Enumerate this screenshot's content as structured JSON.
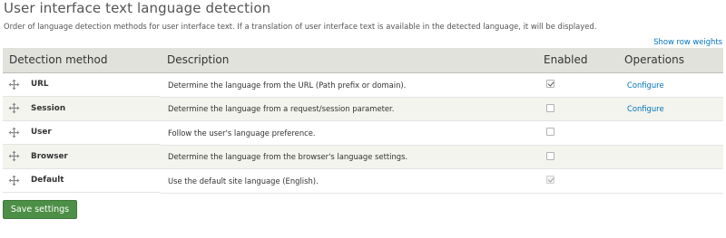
{
  "page": {
    "title": "User interface text language detection",
    "description": "Order of language detection methods for user interface text. If a translation of user interface text is available in the detected language, it will be displayed.",
    "row_weights_link": "Show row weights"
  },
  "table": {
    "headers": {
      "method": "Detection method",
      "description": "Description",
      "enabled": "Enabled",
      "operations": "Operations"
    },
    "rows": [
      {
        "method": "URL",
        "description": "Determine the language from the URL (Path prefix or domain).",
        "enabled": true,
        "disabled": false,
        "operation": "Configure"
      },
      {
        "method": "Session",
        "description": "Determine the language from a request/session parameter.",
        "enabled": false,
        "disabled": false,
        "operation": "Configure"
      },
      {
        "method": "User",
        "description": "Follow the user's language preference.",
        "enabled": false,
        "disabled": false,
        "operation": ""
      },
      {
        "method": "Browser",
        "description": "Determine the language from the browser's language settings.",
        "enabled": false,
        "disabled": false,
        "operation": ""
      },
      {
        "method": "Default",
        "description": "Use the default site language (English).",
        "enabled": true,
        "disabled": true,
        "operation": ""
      }
    ]
  },
  "actions": {
    "save_label": "Save settings"
  },
  "icons": {
    "drag_handle": "move-arrows-icon"
  },
  "colors": {
    "link": "#0074bd",
    "header_bg": "#e1e2dc",
    "even_row_bg": "#f3f4ee",
    "save_button_bg": "#4d8f46"
  }
}
